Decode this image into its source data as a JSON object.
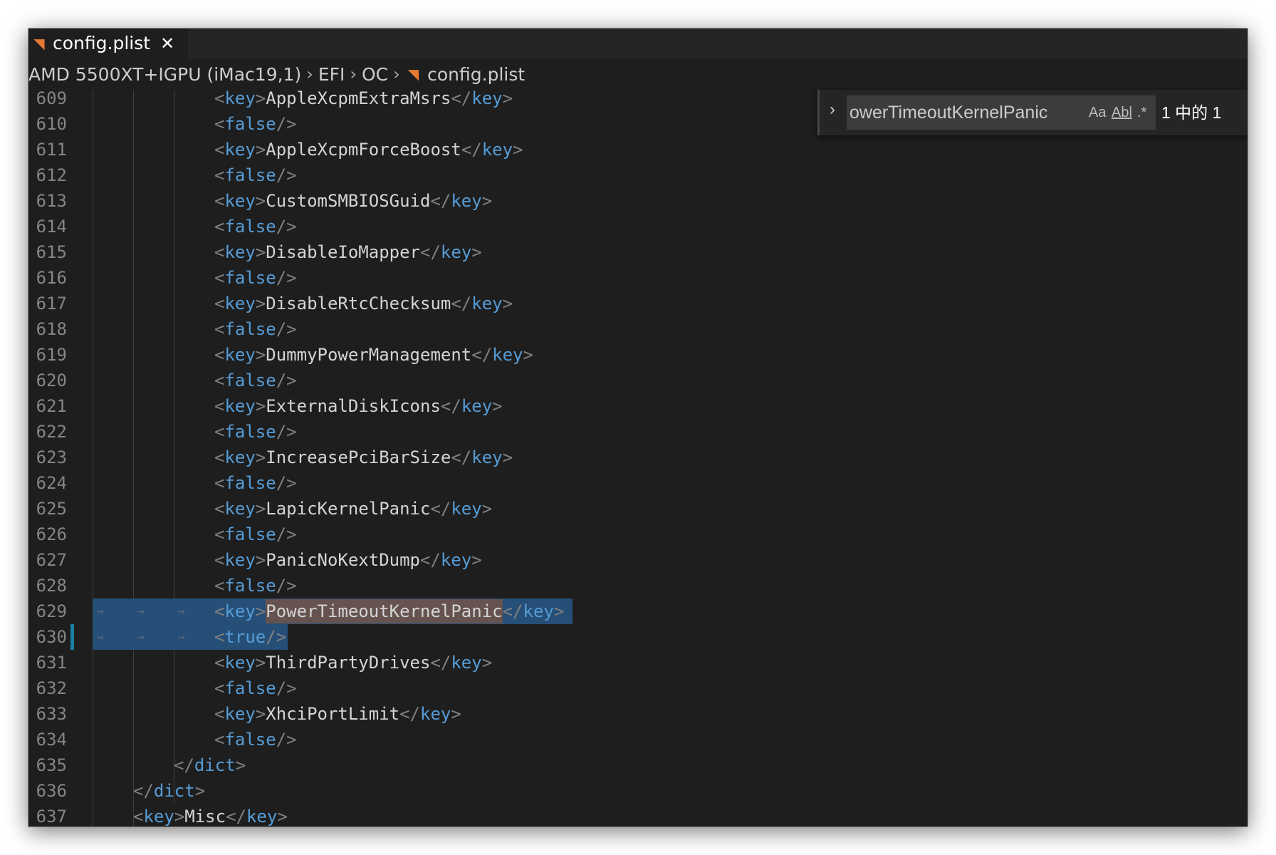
{
  "tab": {
    "label": "config.plist",
    "close": "✕",
    "icon": "rss-file-icon"
  },
  "breadcrumb": {
    "segments": [
      "AMD 5500XT+IGPU (iMac19,1)",
      "EFI",
      "OC"
    ],
    "file": "config.plist"
  },
  "find": {
    "query": "owerTimeoutKernelPanic",
    "match_case": "Aa",
    "whole_word": "Abl",
    "regex": ".*",
    "count": "1 中的 1"
  },
  "lines": [
    {
      "n": "609",
      "indent": 3,
      "tokens": [
        [
          "p",
          "<"
        ],
        [
          "t",
          "key"
        ],
        [
          "p",
          ">"
        ],
        [
          "x",
          "AppleXcpmExtraMsrs"
        ],
        [
          "p",
          "</"
        ],
        [
          "t",
          "key"
        ],
        [
          "p",
          ">"
        ]
      ]
    },
    {
      "n": "610",
      "indent": 3,
      "tokens": [
        [
          "p",
          "<"
        ],
        [
          "t",
          "false"
        ],
        [
          "p",
          "/>"
        ]
      ]
    },
    {
      "n": "611",
      "indent": 3,
      "tokens": [
        [
          "p",
          "<"
        ],
        [
          "t",
          "key"
        ],
        [
          "p",
          ">"
        ],
        [
          "x",
          "AppleXcpmForceBoost"
        ],
        [
          "p",
          "</"
        ],
        [
          "t",
          "key"
        ],
        [
          "p",
          ">"
        ]
      ]
    },
    {
      "n": "612",
      "indent": 3,
      "tokens": [
        [
          "p",
          "<"
        ],
        [
          "t",
          "false"
        ],
        [
          "p",
          "/>"
        ]
      ]
    },
    {
      "n": "613",
      "indent": 3,
      "tokens": [
        [
          "p",
          "<"
        ],
        [
          "t",
          "key"
        ],
        [
          "p",
          ">"
        ],
        [
          "x",
          "CustomSMBIOSGuid"
        ],
        [
          "p",
          "</"
        ],
        [
          "t",
          "key"
        ],
        [
          "p",
          ">"
        ]
      ]
    },
    {
      "n": "614",
      "indent": 3,
      "tokens": [
        [
          "p",
          "<"
        ],
        [
          "t",
          "false"
        ],
        [
          "p",
          "/>"
        ]
      ]
    },
    {
      "n": "615",
      "indent": 3,
      "tokens": [
        [
          "p",
          "<"
        ],
        [
          "t",
          "key"
        ],
        [
          "p",
          ">"
        ],
        [
          "x",
          "DisableIoMapper"
        ],
        [
          "p",
          "</"
        ],
        [
          "t",
          "key"
        ],
        [
          "p",
          ">"
        ]
      ]
    },
    {
      "n": "616",
      "indent": 3,
      "tokens": [
        [
          "p",
          "<"
        ],
        [
          "t",
          "false"
        ],
        [
          "p",
          "/>"
        ]
      ]
    },
    {
      "n": "617",
      "indent": 3,
      "tokens": [
        [
          "p",
          "<"
        ],
        [
          "t",
          "key"
        ],
        [
          "p",
          ">"
        ],
        [
          "x",
          "DisableRtcChecksum"
        ],
        [
          "p",
          "</"
        ],
        [
          "t",
          "key"
        ],
        [
          "p",
          ">"
        ]
      ]
    },
    {
      "n": "618",
      "indent": 3,
      "tokens": [
        [
          "p",
          "<"
        ],
        [
          "t",
          "false"
        ],
        [
          "p",
          "/>"
        ]
      ]
    },
    {
      "n": "619",
      "indent": 3,
      "tokens": [
        [
          "p",
          "<"
        ],
        [
          "t",
          "key"
        ],
        [
          "p",
          ">"
        ],
        [
          "x",
          "DummyPowerManagement"
        ],
        [
          "p",
          "</"
        ],
        [
          "t",
          "key"
        ],
        [
          "p",
          ">"
        ]
      ]
    },
    {
      "n": "620",
      "indent": 3,
      "tokens": [
        [
          "p",
          "<"
        ],
        [
          "t",
          "false"
        ],
        [
          "p",
          "/>"
        ]
      ]
    },
    {
      "n": "621",
      "indent": 3,
      "tokens": [
        [
          "p",
          "<"
        ],
        [
          "t",
          "key"
        ],
        [
          "p",
          ">"
        ],
        [
          "x",
          "ExternalDiskIcons"
        ],
        [
          "p",
          "</"
        ],
        [
          "t",
          "key"
        ],
        [
          "p",
          ">"
        ]
      ]
    },
    {
      "n": "622",
      "indent": 3,
      "tokens": [
        [
          "p",
          "<"
        ],
        [
          "t",
          "false"
        ],
        [
          "p",
          "/>"
        ]
      ]
    },
    {
      "n": "623",
      "indent": 3,
      "tokens": [
        [
          "p",
          "<"
        ],
        [
          "t",
          "key"
        ],
        [
          "p",
          ">"
        ],
        [
          "x",
          "IncreasePciBarSize"
        ],
        [
          "p",
          "</"
        ],
        [
          "t",
          "key"
        ],
        [
          "p",
          ">"
        ]
      ]
    },
    {
      "n": "624",
      "indent": 3,
      "tokens": [
        [
          "p",
          "<"
        ],
        [
          "t",
          "false"
        ],
        [
          "p",
          "/>"
        ]
      ]
    },
    {
      "n": "625",
      "indent": 3,
      "tokens": [
        [
          "p",
          "<"
        ],
        [
          "t",
          "key"
        ],
        [
          "p",
          ">"
        ],
        [
          "x",
          "LapicKernelPanic"
        ],
        [
          "p",
          "</"
        ],
        [
          "t",
          "key"
        ],
        [
          "p",
          ">"
        ]
      ]
    },
    {
      "n": "626",
      "indent": 3,
      "tokens": [
        [
          "p",
          "<"
        ],
        [
          "t",
          "false"
        ],
        [
          "p",
          "/>"
        ]
      ]
    },
    {
      "n": "627",
      "indent": 3,
      "tokens": [
        [
          "p",
          "<"
        ],
        [
          "t",
          "key"
        ],
        [
          "p",
          ">"
        ],
        [
          "x",
          "PanicNoKextDump"
        ],
        [
          "p",
          "</"
        ],
        [
          "t",
          "key"
        ],
        [
          "p",
          ">"
        ]
      ]
    },
    {
      "n": "628",
      "indent": 3,
      "tokens": [
        [
          "p",
          "<"
        ],
        [
          "t",
          "false"
        ],
        [
          "p",
          "/>"
        ]
      ]
    },
    {
      "n": "629",
      "indent": 3,
      "selected": true,
      "find_match": true,
      "tokens": [
        [
          "p",
          "<"
        ],
        [
          "t",
          "key"
        ],
        [
          "p",
          ">"
        ],
        [
          "x",
          "PowerTimeoutKernelPanic"
        ],
        [
          "p",
          "</"
        ],
        [
          "t",
          "key"
        ],
        [
          "p",
          ">"
        ]
      ]
    },
    {
      "n": "630",
      "indent": 3,
      "selected": true,
      "modified": true,
      "tokens": [
        [
          "p",
          "<"
        ],
        [
          "t",
          "true"
        ],
        [
          "p",
          "/>"
        ]
      ]
    },
    {
      "n": "631",
      "indent": 3,
      "tokens": [
        [
          "p",
          "<"
        ],
        [
          "t",
          "key"
        ],
        [
          "p",
          ">"
        ],
        [
          "x",
          "ThirdPartyDrives"
        ],
        [
          "p",
          "</"
        ],
        [
          "t",
          "key"
        ],
        [
          "p",
          ">"
        ]
      ]
    },
    {
      "n": "632",
      "indent": 3,
      "tokens": [
        [
          "p",
          "<"
        ],
        [
          "t",
          "false"
        ],
        [
          "p",
          "/>"
        ]
      ]
    },
    {
      "n": "633",
      "indent": 3,
      "tokens": [
        [
          "p",
          "<"
        ],
        [
          "t",
          "key"
        ],
        [
          "p",
          ">"
        ],
        [
          "x",
          "XhciPortLimit"
        ],
        [
          "p",
          "</"
        ],
        [
          "t",
          "key"
        ],
        [
          "p",
          ">"
        ]
      ]
    },
    {
      "n": "634",
      "indent": 3,
      "tokens": [
        [
          "p",
          "<"
        ],
        [
          "t",
          "false"
        ],
        [
          "p",
          "/>"
        ]
      ]
    },
    {
      "n": "635",
      "indent": 2,
      "tokens": [
        [
          "p",
          "</"
        ],
        [
          "t",
          "dict"
        ],
        [
          "p",
          ">"
        ]
      ]
    },
    {
      "n": "636",
      "indent": 1,
      "tokens": [
        [
          "p",
          "</"
        ],
        [
          "t",
          "dict"
        ],
        [
          "p",
          ">"
        ]
      ]
    },
    {
      "n": "637",
      "indent": 1,
      "tokens": [
        [
          "p",
          "<"
        ],
        [
          "t",
          "key"
        ],
        [
          "p",
          ">"
        ],
        [
          "x",
          "Misc"
        ],
        [
          "p",
          "</"
        ],
        [
          "t",
          "key"
        ],
        [
          "p",
          ">"
        ]
      ]
    }
  ],
  "colors": {
    "editor_bg": "#1e1e1e",
    "tag": "#569cd6",
    "punctuation": "#808080",
    "text": "#d4d4d4",
    "line_number": "#858585",
    "selection": "#264f78",
    "find_match": "#ea5c00",
    "modified_marker": "#1b81a8",
    "file_icon": "#e37933"
  }
}
